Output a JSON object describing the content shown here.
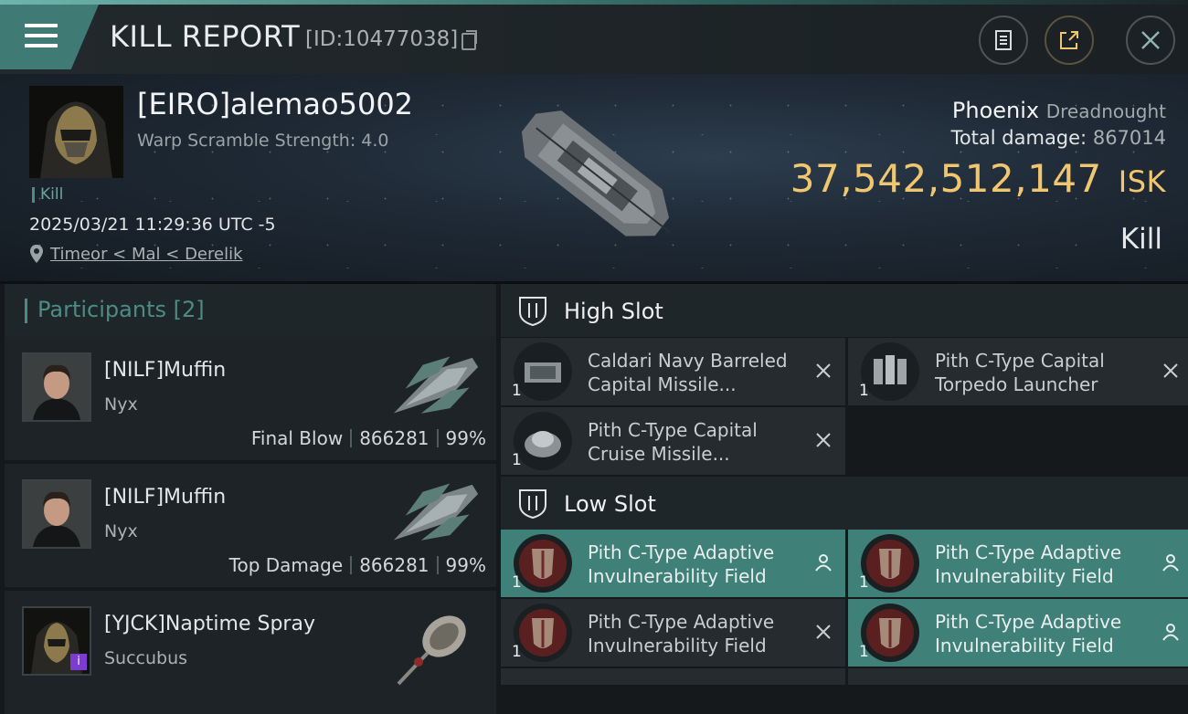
{
  "header": {
    "title": "KILL REPORT",
    "report_id": "[ID:10477038]",
    "icons": {
      "menu": "hamburger-menu-icon",
      "copy": "copy-icon",
      "clipboard": "clipboard-icon",
      "share": "share-icon",
      "close": "close-icon"
    }
  },
  "victim": {
    "pilot_name": "[EIRO]alemao5002",
    "warp_scramble": "Warp Scramble Strength: 4.0",
    "tag": "Kill",
    "datetime": "2025/03/21 11:29:36 UTC -5",
    "location": "Timeor < Mal < Derelik",
    "ship_name": "Phoenix",
    "ship_class": "Dreadnought",
    "total_damage_label": "Total damage:",
    "total_damage": "867014",
    "isk_value": "37,542,512,147",
    "isk_unit": "ISK",
    "result": "Kill"
  },
  "participants": {
    "title": "Participants [2]",
    "items": [
      {
        "name": "[NILF]Muffin",
        "ship": "Nyx",
        "label": "Final Blow",
        "damage": "866281",
        "percent": "99%"
      },
      {
        "name": "[NILF]Muffin",
        "ship": "Nyx",
        "label": "Top Damage",
        "damage": "866281",
        "percent": "99%"
      },
      {
        "name": "[YJCK]Naptime Spray",
        "ship": "Succubus",
        "label": "",
        "damage": "",
        "percent": "",
        "badge": "i"
      }
    ]
  },
  "slots": {
    "high": {
      "label": "High Slot",
      "modules": [
        {
          "name": "Caldari Navy Barreled Capital Missile...",
          "qty": "1"
        },
        {
          "name": "Pith C-Type Capital Torpedo Launcher",
          "qty": "1"
        },
        {
          "name": "Pith C-Type Capital Cruise Missile...",
          "qty": "1"
        }
      ]
    },
    "low": {
      "label": "Low Slot",
      "modules": [
        {
          "name": "Pith C-Type Adaptive Invulnerability Field",
          "qty": "1"
        },
        {
          "name": "Pith C-Type Adaptive Invulnerability Field",
          "qty": "1"
        },
        {
          "name": "Pith C-Type Adaptive Invulnerability Field",
          "qty": "1"
        },
        {
          "name": "Pith C-Type Adaptive Invulnerability Field",
          "qty": "1"
        }
      ]
    }
  },
  "colors": {
    "accent": "#4c8c85",
    "isk": "#f0c770",
    "active_module": "#3f8079",
    "badge": "#7d3bd1"
  }
}
